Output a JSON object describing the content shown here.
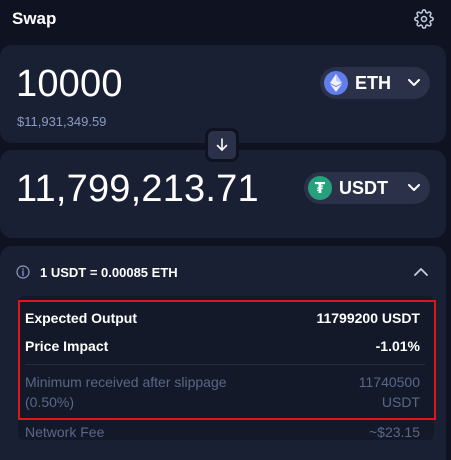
{
  "header": {
    "title": "Swap",
    "settings_icon": "gear-icon"
  },
  "from": {
    "amount": "10000",
    "usd_value": "$11,931,349.59",
    "token": {
      "symbol": "ETH",
      "icon": "ethereum-icon",
      "color": "#627eea"
    }
  },
  "switch": {
    "icon": "arrow-down-icon"
  },
  "to": {
    "amount": "11,799,213.71",
    "token": {
      "symbol": "USDT",
      "icon": "tether-icon",
      "color": "#26a17b",
      "glyph": "₮"
    }
  },
  "details": {
    "rate": "1 USDT = 0.00085 ETH",
    "rows": [
      {
        "label": "Expected Output",
        "value": "11799200 USDT"
      },
      {
        "label": "Price Impact",
        "value": "-1.01%"
      }
    ],
    "min_received": {
      "label_line1": "Minimum received after slippage",
      "label_line2": "(0.50%)",
      "value_line1": "11740500",
      "value_line2": "USDT"
    },
    "network_fee": {
      "label": "Network Fee",
      "value": "~$23.15"
    }
  },
  "colors": {
    "background": "#0e1221",
    "panel": "#1a2033",
    "highlight": "#e0141b",
    "muted_text": "#5a6788"
  }
}
